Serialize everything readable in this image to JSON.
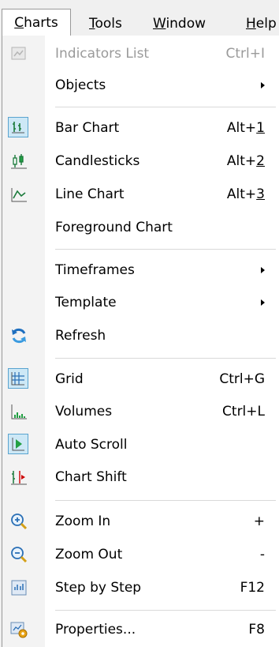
{
  "menubar": {
    "charts": {
      "pre": "",
      "u": "C",
      "post": "harts"
    },
    "tools": {
      "pre": "",
      "u": "T",
      "post": "ools"
    },
    "window": {
      "pre": "",
      "u": "W",
      "post": "indow"
    },
    "help": {
      "pre": "",
      "u": "H",
      "post": "elp"
    }
  },
  "menu": {
    "indicators_list": {
      "label": "Indicators List",
      "shortcut": "Ctrl+I"
    },
    "objects": {
      "label": "Objects"
    },
    "bar_chart": {
      "label": "Bar Chart",
      "shortcut_pre": "Alt+",
      "shortcut_u": "1"
    },
    "candlesticks": {
      "label": "Candlesticks",
      "shortcut_pre": "Alt+",
      "shortcut_u": "2"
    },
    "line_chart": {
      "label": "Line Chart",
      "shortcut_pre": "Alt+",
      "shortcut_u": "3"
    },
    "foreground_chart": {
      "label": "Foreground Chart"
    },
    "timeframes": {
      "label": "Timeframes"
    },
    "template": {
      "label": "Template"
    },
    "refresh": {
      "label": "Refresh"
    },
    "grid": {
      "label": "Grid",
      "shortcut": "Ctrl+G"
    },
    "volumes": {
      "label": "Volumes",
      "shortcut": "Ctrl+L"
    },
    "auto_scroll": {
      "label": "Auto Scroll"
    },
    "chart_shift": {
      "label": "Chart Shift"
    },
    "zoom_in": {
      "label": "Zoom In",
      "shortcut": "+"
    },
    "zoom_out": {
      "label": "Zoom Out",
      "shortcut": "-"
    },
    "step_by_step": {
      "label": "Step by Step",
      "shortcut": "F12"
    },
    "properties": {
      "label": "Properties...",
      "shortcut": "F8"
    }
  },
  "colors": {
    "check_bg": "#cde8f6",
    "check_border": "#5aa4cf",
    "disabled_text": "#9a9a9a"
  }
}
